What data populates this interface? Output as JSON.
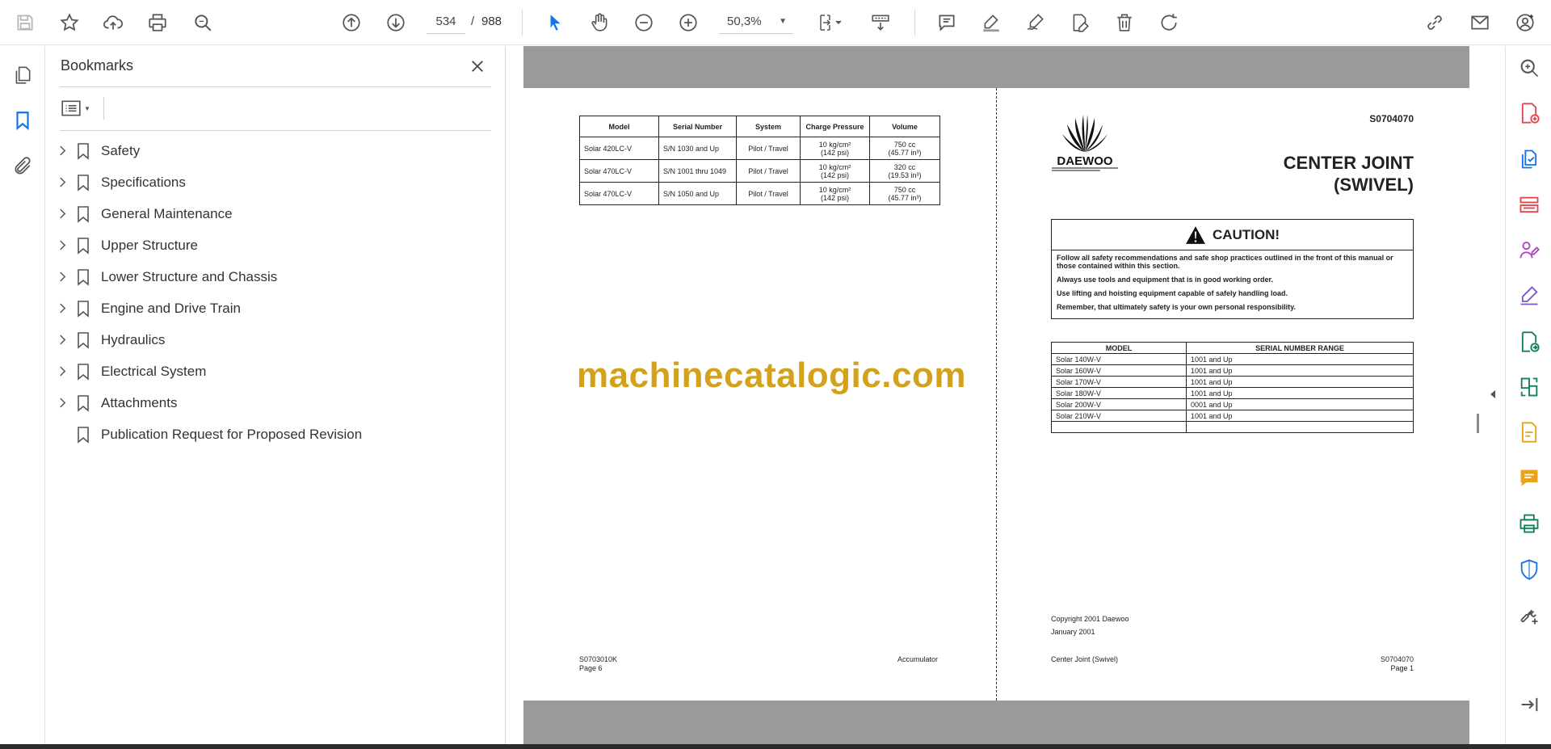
{
  "toolbar": {
    "page_current": "534",
    "page_separator": "/",
    "page_total": "988",
    "zoom": "50,3%"
  },
  "bookmarks": {
    "title": "Bookmarks",
    "items": [
      {
        "label": "Safety",
        "expandable": true
      },
      {
        "label": "Specifications",
        "expandable": true
      },
      {
        "label": "General Maintenance",
        "expandable": true
      },
      {
        "label": "Upper Structure",
        "expandable": true
      },
      {
        "label": "Lower Structure and Chassis",
        "expandable": true
      },
      {
        "label": "Engine and Drive Train",
        "expandable": true
      },
      {
        "label": "Hydraulics",
        "expandable": true
      },
      {
        "label": "Electrical System",
        "expandable": true
      },
      {
        "label": "Attachments",
        "expandable": true
      },
      {
        "label": "Publication Request for Proposed Revision",
        "expandable": false
      }
    ]
  },
  "left_page": {
    "table": {
      "headers": [
        "Model",
        "Serial Number",
        "System",
        "Charge Pressure",
        "Volume"
      ],
      "rows": [
        [
          "Solar 420LC-V",
          "S/N 1030 and Up",
          "Pilot / Travel",
          "10 kg/cm²",
          "(142 psi)",
          "750 cc",
          "(45.77 in³)"
        ],
        [
          "Solar 470LC-V",
          "S/N 1001 thru 1049",
          "Pilot / Travel",
          "10 kg/cm²",
          "(142 psi)",
          "320 cc",
          "(19.53 in³)"
        ],
        [
          "Solar 470LC-V",
          "S/N 1050 and Up",
          "Pilot / Travel",
          "10 kg/cm²",
          "(142 psi)",
          "750 cc",
          "(45.77 in³)"
        ]
      ]
    },
    "watermark": "machinecatalogic.com",
    "footer_left_1": "S0703010K",
    "footer_left_2": "Page 6",
    "footer_right": "Accumulator"
  },
  "right_page": {
    "doc_number": "S0704070",
    "logo_text": "DAEWOO",
    "title_line1": "CENTER JOINT",
    "title_line2": "(SWIVEL)",
    "caution": {
      "heading": "CAUTION!",
      "lines": [
        "Follow all safety recommendations and safe shop practices outlined in the front of this manual or those contained within this section.",
        "Always use tools and equipment that is in good working order.",
        "Use lifting and hoisting equipment capable of safely handling load.",
        "Remember, that ultimately safety is your own personal responsibility."
      ]
    },
    "model_table": {
      "headers": [
        "MODEL",
        "SERIAL NUMBER RANGE"
      ],
      "rows": [
        [
          "Solar 140W-V",
          "1001 and Up"
        ],
        [
          "Solar 160W-V",
          "1001 and Up"
        ],
        [
          "Solar 170W-V",
          "1001 and Up"
        ],
        [
          "Solar 180W-V",
          "1001 and Up"
        ],
        [
          "Solar 200W-V",
          "0001 and Up"
        ],
        [
          "Solar 210W-V",
          "1001 and Up"
        ],
        [
          "",
          ""
        ]
      ]
    },
    "copyright": "Copyright 2001 Daewoo",
    "date": "January 2001",
    "footer_left": "Center Joint (Swivel)",
    "footer_right_1": "S0704070",
    "footer_right_2": "Page 1"
  },
  "colors": {
    "accent_blue": "#1473e6",
    "watermark": "#d4a21a",
    "page_gray": "#9a9a9a"
  }
}
